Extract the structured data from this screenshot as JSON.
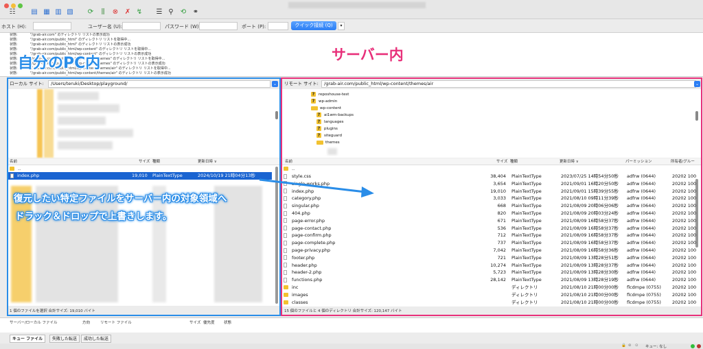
{
  "window": {
    "traffic_colors": [
      "#ee5b53",
      "#f5be3a",
      "#5ec545"
    ]
  },
  "toolbar": {
    "icons": [
      "site-manager-icon",
      "document-icon",
      "panel-toggle-icon",
      "panel-toggle-icon",
      "panel-toggle-icon",
      "refresh-icon",
      "filter-icon",
      "cancel-icon",
      "disconnect-icon",
      "reconnect-icon",
      "compare-icon",
      "search-remote-icon",
      "sync-browse-icon",
      "binoculars-icon"
    ]
  },
  "quickconnect": {
    "host_label": "ホスト (H):",
    "user_label": "ユーザー名 (U):",
    "password_label": "パスワード (W):",
    "port_label": "ポート (P):",
    "button": "クイック接続 (Q)",
    "dropdown": "▾"
  },
  "log": [
    {
      "status": "状態:",
      "msg": "\"/grab-air.com\" のディレクトリ リストの表示成功"
    },
    {
      "status": "状態:",
      "msg": "\"/grab-air.com/public_html\" のディレクトリ リストを取得中..."
    },
    {
      "status": "状態:",
      "msg": "\"/grab-air.com/public_html\" のディレクトリ リストの表示成功"
    },
    {
      "status": "状態:",
      "msg": "\"/grab-air.com/public_html/wp-content\" のディレクトリ リストを取得中..."
    },
    {
      "status": "状態:",
      "msg": "\"/grab-air.com/public_html/wp-content\" のディレクトリ リストの表示成功"
    },
    {
      "status": "状態:",
      "msg": "\"/grab-air.com/public_html/wp-content/themes\" のディレクトリ リストを取得中..."
    },
    {
      "status": "状態:",
      "msg": "\"/grab-air.com/public_html/wp-content/themes\" のディレクトリ リストの表示成功"
    },
    {
      "status": "状態:",
      "msg": "\"/grab-air.com/public_html/wp-content/themes/air\" のディレクトリ リストを取得中..."
    },
    {
      "status": "状態:",
      "msg": "\"/grab-air.com/public_html/wp-content/themes/air\" のディレクトリ リストの表示成功"
    }
  ],
  "annotations": {
    "local": "自分のPC内",
    "server": "サーバー内",
    "instruction_line1": "復元したい特定ファイルをサーバー内の対象領域へ",
    "instruction_line2": "ドラック＆ドロップで上書きします。",
    "colors": {
      "blue": "#2a8de8",
      "pink": "#e8307a"
    }
  },
  "local": {
    "site_label": "ローカル サイト:",
    "path": "/Users/teruki/Desktop/playground/",
    "columns": [
      "名前",
      "サイズ",
      "種類",
      "更新日時 ∨"
    ],
    "parent": "..",
    "selected": {
      "name": "index.php",
      "size": "19,010",
      "type": "PlainTextType",
      "modified": "2024/10/19 21時04分13秒"
    },
    "status": "1 個のファイルを選択 合計サイズ: 19,010 バイト"
  },
  "remote": {
    "site_label": "リモート サイト:",
    "path": "/grab-air.com/public_html/wp-content/themes/air",
    "tree": [
      {
        "name": "reposhouse-test",
        "icon": "?"
      },
      {
        "name": "wp-admin",
        "icon": "?"
      },
      {
        "name": "wp-content",
        "icon": "folder",
        "open": true
      },
      {
        "name": "ai1wm-backups",
        "icon": "?"
      },
      {
        "name": "languages",
        "icon": "?"
      },
      {
        "name": "plugins",
        "icon": "?"
      },
      {
        "name": "siteguard",
        "icon": "?"
      },
      {
        "name": "themes",
        "icon": "folder",
        "open": true
      }
    ],
    "columns": [
      "名前",
      "サイズ",
      "種類",
      "更新日時 ∨",
      "パーミッション",
      "所有者/グルー"
    ],
    "parent": "..",
    "files": [
      {
        "name": "style.css",
        "size": "38,404",
        "type": "PlainTextType",
        "modified": "2023/07/25 14時54分50秒",
        "perm": "adfrw (0644)",
        "owner": "20202 100"
      },
      {
        "name": "single-works.php",
        "size": "3,654",
        "type": "PlainTextType",
        "modified": "2021/09/01 16時20分50秒",
        "perm": "adfrw (0644)",
        "owner": "20202 100"
      },
      {
        "name": "index.php",
        "size": "19,010",
        "type": "PlainTextType",
        "modified": "2021/09/01 15時39分55秒",
        "perm": "adfrw (0644)",
        "owner": "20202 100"
      },
      {
        "name": "category.php",
        "size": "3,033",
        "type": "PlainTextType",
        "modified": "2021/08/10 09時11分39秒",
        "perm": "adfrw (0644)",
        "owner": "20202 100"
      },
      {
        "name": "singular.php",
        "size": "668",
        "type": "PlainTextType",
        "modified": "2021/08/09 20時06分06秒",
        "perm": "adfrw (0644)",
        "owner": "20202 100"
      },
      {
        "name": "404.php",
        "size": "820",
        "type": "PlainTextType",
        "modified": "2021/08/09 20時03分24秒",
        "perm": "adfrw (0644)",
        "owner": "20202 100"
      },
      {
        "name": "page-error.php",
        "size": "671",
        "type": "PlainTextType",
        "modified": "2021/08/09 16時58分37秒",
        "perm": "adfrw (0644)",
        "owner": "20202 100"
      },
      {
        "name": "page-contact.php",
        "size": "536",
        "type": "PlainTextType",
        "modified": "2021/08/09 16時58分37秒",
        "perm": "adfrw (0644)",
        "owner": "20202 100"
      },
      {
        "name": "page-confirm.php",
        "size": "712",
        "type": "PlainTextType",
        "modified": "2021/08/09 16時58分37秒",
        "perm": "adfrw (0644)",
        "owner": "20202 100"
      },
      {
        "name": "page-complete.php",
        "size": "737",
        "type": "PlainTextType",
        "modified": "2021/08/09 16時58分37秒",
        "perm": "adfrw (0644)",
        "owner": "20202 100"
      },
      {
        "name": "page-privacy.php",
        "size": "7,042",
        "type": "PlainTextType",
        "modified": "2021/08/09 16時58分36秒",
        "perm": "adfrw (0644)",
        "owner": "20202 100"
      },
      {
        "name": "footer.php",
        "size": "721",
        "type": "PlainTextType",
        "modified": "2021/08/09 13時28分51秒",
        "perm": "adfrw (0644)",
        "owner": "20202 100"
      },
      {
        "name": "header.php",
        "size": "10,274",
        "type": "PlainTextType",
        "modified": "2021/08/09 13時28分37秒",
        "perm": "adfrw (0644)",
        "owner": "20202 100"
      },
      {
        "name": "header-2.php",
        "size": "5,723",
        "type": "PlainTextType",
        "modified": "2021/08/09 13時28分30秒",
        "perm": "adfrw (0644)",
        "owner": "20202 100"
      },
      {
        "name": "functions.php",
        "size": "28,142",
        "type": "PlainTextType",
        "modified": "2021/08/09 13時28分19秒",
        "perm": "adfrw (0644)",
        "owner": "20202 100"
      },
      {
        "name": "inc",
        "size": "",
        "type": "ディレクトリ",
        "modified": "2021/08/10 21時00分00秒",
        "perm": "flcdmpe (0755)",
        "owner": "20202 100",
        "folder": true
      },
      {
        "name": "images",
        "size": "",
        "type": "ディレクトリ",
        "modified": "2021/08/10 21時00分00秒",
        "perm": "flcdmpe (0755)",
        "owner": "20202 100",
        "folder": true
      },
      {
        "name": "classes",
        "size": "",
        "type": "ディレクトリ",
        "modified": "2021/08/10 21時00分00秒",
        "perm": "flcdmpe (0755)",
        "owner": "20202 100",
        "folder": true
      }
    ],
    "status": "15 個のファイルと 4 個のディレクトリ 合計サイズ: 120,147 バイト"
  },
  "queue": {
    "columns": [
      "サーバー/ローカル ファイル",
      "方向",
      "リモート ファイル",
      "サイズ",
      "優先度",
      "状態"
    ]
  },
  "tabs": [
    "キュー ファイル",
    "失敗した転送",
    "成功した転送"
  ],
  "statusbar": {
    "queue": "キュー: なし"
  }
}
